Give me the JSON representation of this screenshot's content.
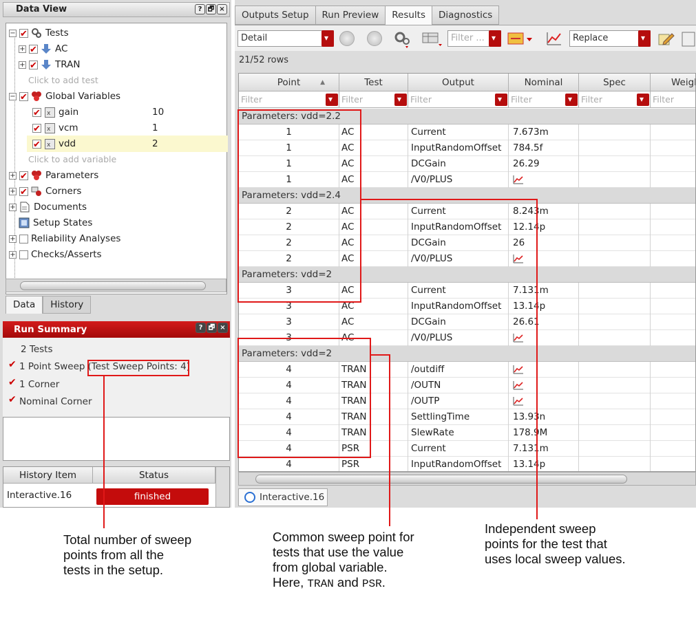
{
  "left_panel": {
    "data_view_title": "Data View",
    "title_buttons": [
      "?",
      "🗗",
      "×"
    ],
    "tree": {
      "tests": "Tests",
      "ac": "AC",
      "tran": "TRAN",
      "click_add_test": "Click to add test",
      "global_vars": "Global Variables",
      "variables": [
        {
          "name": "gain",
          "value": "10"
        },
        {
          "name": "vcm",
          "value": "1"
        },
        {
          "name": "vdd",
          "value": "2"
        }
      ],
      "click_add_var": "Click to add variable",
      "parameters": "Parameters",
      "corners": "Corners",
      "documents": "Documents",
      "setup_states": "Setup States",
      "reliability": "Reliability Analyses",
      "checks": "Checks/Asserts"
    },
    "subtabs": [
      "Data",
      "History"
    ],
    "run_summary": {
      "title": "Run Summary",
      "tests": "2 Tests",
      "point_sweep": "1 Point Sweep",
      "sweep_points": "(Test Sweep Points: 4)",
      "corner": "1 Corner",
      "nominal": "Nominal Corner"
    },
    "history": {
      "col_item": "History Item",
      "col_status": "Status",
      "item": "Interactive.16",
      "status": "finished"
    }
  },
  "right_panel": {
    "tabs": [
      "Outputs Setup",
      "Run Preview",
      "Results",
      "Diagnostics"
    ],
    "active_tab": "Results",
    "toolbar": {
      "view_mode": "Detail",
      "filter_placeholder": "Filter ...",
      "replace_mode": "Replace"
    },
    "row_count": "21/52 rows",
    "columns": [
      "Point",
      "Test",
      "Output",
      "Nominal",
      "Spec",
      "Weigh"
    ],
    "filter_text": "Filter",
    "rows": [
      {
        "group": "Parameters: vdd=2.2"
      },
      {
        "point": "1",
        "test": "AC",
        "output": "Current",
        "nominal": "7.673m"
      },
      {
        "point": "1",
        "test": "AC",
        "output": "InputRandomOffset",
        "nominal": "784.5f"
      },
      {
        "point": "1",
        "test": "AC",
        "output": "DCGain",
        "nominal": "26.29"
      },
      {
        "point": "1",
        "test": "AC",
        "output": "/V0/PLUS",
        "nominal": "",
        "wave": true
      },
      {
        "group": "Parameters: vdd=2.4"
      },
      {
        "point": "2",
        "test": "AC",
        "output": "Current",
        "nominal": "8.243m"
      },
      {
        "point": "2",
        "test": "AC",
        "output": "InputRandomOffset",
        "nominal": "12.14p"
      },
      {
        "point": "2",
        "test": "AC",
        "output": "DCGain",
        "nominal": "26"
      },
      {
        "point": "2",
        "test": "AC",
        "output": "/V0/PLUS",
        "nominal": "",
        "wave": true
      },
      {
        "group": "Parameters: vdd=2"
      },
      {
        "point": "3",
        "test": "AC",
        "output": "Current",
        "nominal": "7.131m"
      },
      {
        "point": "3",
        "test": "AC",
        "output": "InputRandomOffset",
        "nominal": "13.14p"
      },
      {
        "point": "3",
        "test": "AC",
        "output": "DCGain",
        "nominal": "26.61"
      },
      {
        "point": "3",
        "test": "AC",
        "output": "/V0/PLUS",
        "nominal": "",
        "wave": true
      },
      {
        "group": "Parameters: vdd=2"
      },
      {
        "point": "4",
        "test": "TRAN",
        "output": "/outdiff",
        "nominal": "",
        "wave": true
      },
      {
        "point": "4",
        "test": "TRAN",
        "output": "/OUTN",
        "nominal": "",
        "wave": true
      },
      {
        "point": "4",
        "test": "TRAN",
        "output": "/OUTP",
        "nominal": "",
        "wave": true
      },
      {
        "point": "4",
        "test": "TRAN",
        "output": "SettlingTime",
        "nominal": "13.93n"
      },
      {
        "point": "4",
        "test": "TRAN",
        "output": "SlewRate",
        "nominal": "178.9M"
      },
      {
        "point": "4",
        "test": "PSR",
        "output": "Current",
        "nominal": "7.131m"
      },
      {
        "point": "4",
        "test": "PSR",
        "output": "InputRandomOffset",
        "nominal": "13.14p"
      }
    ],
    "bottom_tab": "Interactive.16"
  },
  "annotations": {
    "left": [
      "Total number of sweep",
      "points from all the",
      "tests in the setup."
    ],
    "middle": [
      "Common sweep point for",
      "tests that use the value",
      "from global variable."
    ],
    "middle_last_prefix": "Here, ",
    "middle_tran": "TRAN",
    "middle_and": " and ",
    "middle_psr": "PSR",
    "middle_period": ".",
    "right": [
      "Independent sweep",
      "points for the test that",
      "uses local sweep values."
    ]
  },
  "colors": {
    "accent_red": "#c40c0c",
    "annotation_red": "#e01818",
    "highlight_yellow": "#fbf8cf"
  }
}
